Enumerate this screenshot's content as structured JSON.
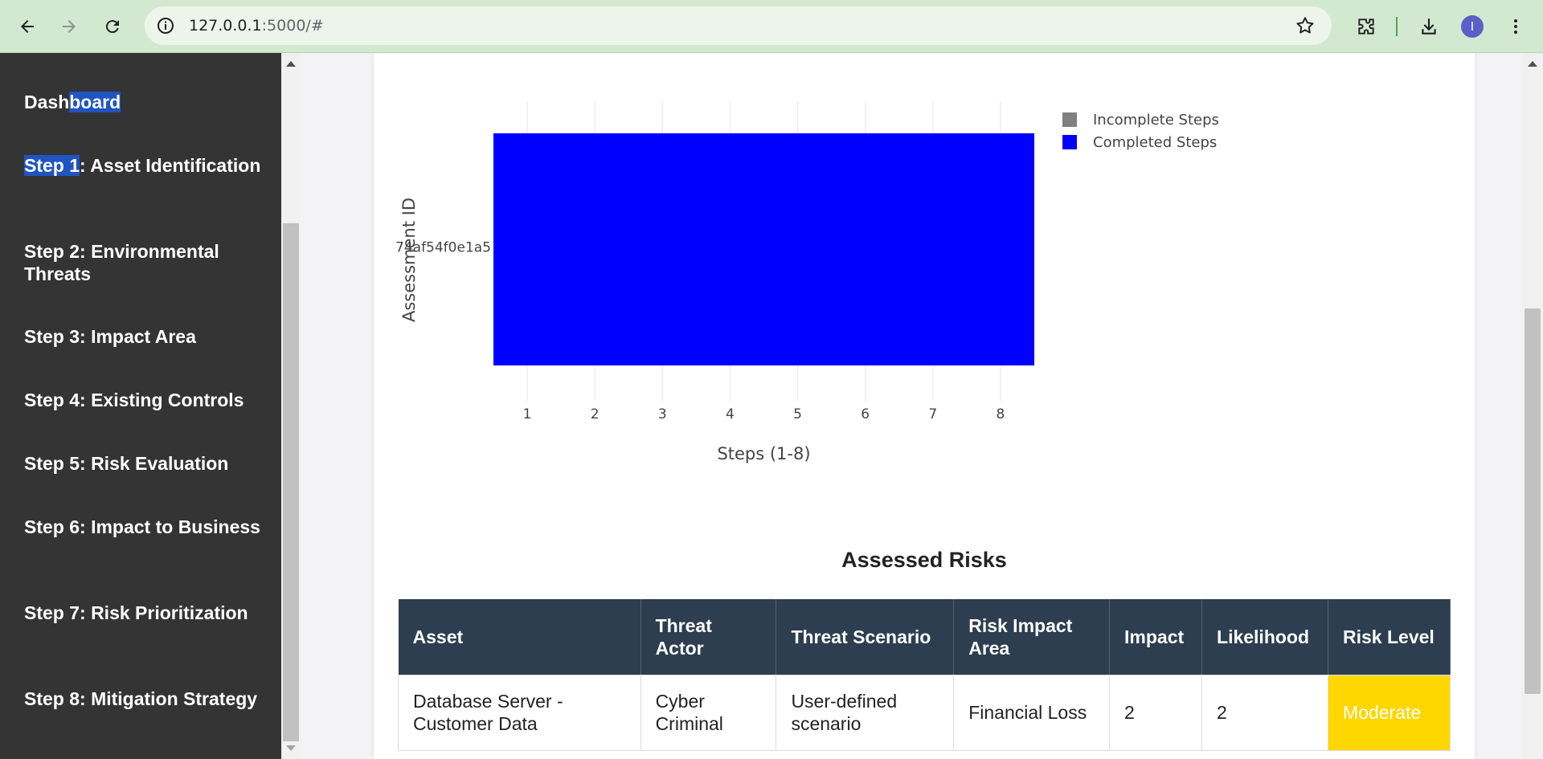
{
  "browser": {
    "url_host": "127.0.0.1",
    "url_rest": ":5000/#",
    "profile_initial": "I"
  },
  "sidebar": {
    "items": [
      {
        "pre": "Dash",
        "hl": "board",
        "post": ""
      },
      {
        "pre": "",
        "hl": "Step 1",
        "post": ": Asset Identification"
      },
      {
        "pre": "Step 2: Environmental Threats",
        "hl": "",
        "post": ""
      },
      {
        "pre": "Step 3: Impact Area",
        "hl": "",
        "post": ""
      },
      {
        "pre": "Step 4: Existing Controls",
        "hl": "",
        "post": ""
      },
      {
        "pre": "Step 5: Risk Evaluation",
        "hl": "",
        "post": ""
      },
      {
        "pre": "Step 6: Impact to Business",
        "hl": "",
        "post": ""
      },
      {
        "pre": "Step 7: Risk Prioritization",
        "hl": "",
        "post": ""
      },
      {
        "pre": "Step 8: Mitigation Strategy",
        "hl": "",
        "post": ""
      }
    ]
  },
  "chart_data": {
    "type": "bar",
    "orientation": "horizontal",
    "categories": [
      "74af54f0e1a5"
    ],
    "series": [
      {
        "name": "Incomplete Steps",
        "color": "#808080",
        "values": [
          0
        ]
      },
      {
        "name": "Completed Steps",
        "color": "#0000ff",
        "values": [
          8
        ]
      }
    ],
    "x_ticks": [
      "1",
      "2",
      "3",
      "4",
      "5",
      "6",
      "7",
      "8"
    ],
    "xlabel": "Steps (1-8)",
    "ylabel": "Assessment ID",
    "xlim": [
      0.5,
      8.5
    ],
    "legend_position": "top-right",
    "grid": true
  },
  "risks": {
    "title": "Assessed Risks",
    "columns": [
      "Asset",
      "Threat Actor",
      "Threat Scenario",
      "Risk Impact Area",
      "Impact",
      "Likelihood",
      "Risk Level"
    ],
    "rows": [
      [
        "Database Server - Customer Data",
        "Cyber Criminal",
        "User-defined scenario",
        "Financial Loss",
        "2",
        "2",
        "Moderate"
      ]
    ],
    "risk_level_color": "#ffd700"
  }
}
